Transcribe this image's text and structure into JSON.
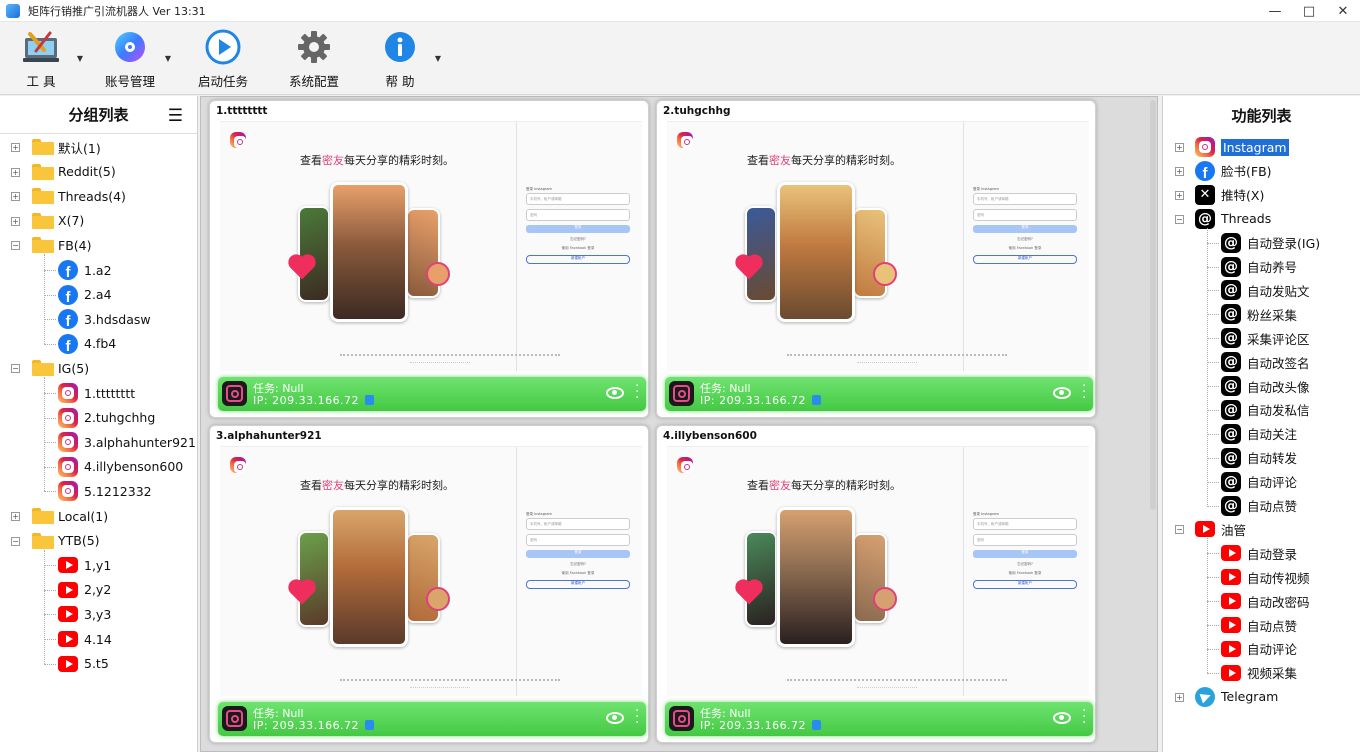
{
  "window": {
    "title": "矩阵行销推广引流机器人 Ver 13:31"
  },
  "toolbar": {
    "items": [
      {
        "label": "工  具",
        "icon": "tools-icon",
        "dropdown": true
      },
      {
        "label": "账号管理",
        "icon": "account-disc-icon",
        "dropdown": true
      },
      {
        "label": "启动任务",
        "icon": "play-icon",
        "dropdown": false
      },
      {
        "label": "系统配置",
        "icon": "gear-icon",
        "dropdown": false
      },
      {
        "label": "帮  助",
        "icon": "info-icon",
        "dropdown": true
      }
    ]
  },
  "groups": {
    "title": "分组列表",
    "nodes": [
      {
        "label": "默认(1)",
        "type": "folder",
        "level": 0
      },
      {
        "label": "Reddit(5)",
        "type": "folder",
        "level": 0
      },
      {
        "label": "Threads(4)",
        "type": "folder",
        "level": 0
      },
      {
        "label": "X(7)",
        "type": "folder",
        "level": 0
      },
      {
        "label": "FB(4)",
        "type": "folder",
        "level": 0,
        "expanded": true
      },
      {
        "label": "1.a2",
        "type": "fb",
        "level": 1
      },
      {
        "label": "2.a4",
        "type": "fb",
        "level": 1
      },
      {
        "label": "3.hdsdasw",
        "type": "fb",
        "level": 1
      },
      {
        "label": "4.fb4",
        "type": "fb",
        "level": 1
      },
      {
        "label": "IG(5)",
        "type": "folder",
        "level": 0,
        "expanded": true
      },
      {
        "label": "1.tttttttt",
        "type": "ig",
        "level": 1
      },
      {
        "label": "2.tuhgchhg",
        "type": "ig",
        "level": 1
      },
      {
        "label": "3.alphahunter921",
        "type": "ig",
        "level": 1
      },
      {
        "label": "4.illybenson600",
        "type": "ig",
        "level": 1
      },
      {
        "label": "5.1212332",
        "type": "ig",
        "level": 1
      },
      {
        "label": "Local(1)",
        "type": "folder",
        "level": 0
      },
      {
        "label": "YTB(5)",
        "type": "folder",
        "level": 0,
        "expanded": true
      },
      {
        "label": "1,y1",
        "type": "yt",
        "level": 1
      },
      {
        "label": "2,y2",
        "type": "yt",
        "level": 1
      },
      {
        "label": "3,y3",
        "type": "yt",
        "level": 1
      },
      {
        "label": "4.14",
        "type": "yt",
        "level": 1
      },
      {
        "label": "5.t5",
        "type": "yt",
        "level": 1
      }
    ]
  },
  "browsers": [
    {
      "title": "1.tttttttt",
      "task": "任务: Null",
      "ip": "IP: 209.33.166.72"
    },
    {
      "title": "2.tuhgchhg",
      "task": "任务: Null",
      "ip": "IP: 209.33.166.72"
    },
    {
      "title": "3.alphahunter921",
      "task": "任务: Null",
      "ip": "IP: 209.33.166.72"
    },
    {
      "title": "4.illybenson600",
      "task": "任务: Null",
      "ip": "IP: 209.33.166.72"
    }
  ],
  "ig_page": {
    "slogan_pre": "查看",
    "slogan_hl": "密友",
    "slogan_post": "每天分享的精彩时刻。"
  },
  "functions": {
    "title": "功能列表",
    "nodes": [
      {
        "label": "Instagram",
        "type": "ig",
        "level": 0,
        "selected": true
      },
      {
        "label": "脸书(FB)",
        "type": "fb",
        "level": 0
      },
      {
        "label": "推特(X)",
        "type": "x",
        "level": 0
      },
      {
        "label": "Threads",
        "type": "th",
        "level": 0,
        "expanded": true
      },
      {
        "label": "自动登录(IG)",
        "type": "th",
        "level": 1
      },
      {
        "label": "自动养号",
        "type": "th",
        "level": 1
      },
      {
        "label": "自动发贴文",
        "type": "th",
        "level": 1
      },
      {
        "label": "粉丝采集",
        "type": "th",
        "level": 1
      },
      {
        "label": "采集评论区",
        "type": "th",
        "level": 1
      },
      {
        "label": "自动改签名",
        "type": "th",
        "level": 1
      },
      {
        "label": "自动改头像",
        "type": "th",
        "level": 1
      },
      {
        "label": "自动发私信",
        "type": "th",
        "level": 1
      },
      {
        "label": "自动关注",
        "type": "th",
        "level": 1
      },
      {
        "label": "自动转发",
        "type": "th",
        "level": 1
      },
      {
        "label": "自动评论",
        "type": "th",
        "level": 1
      },
      {
        "label": "自动点赞",
        "type": "th",
        "level": 1
      },
      {
        "label": "油管",
        "type": "yt",
        "level": 0,
        "expanded": true
      },
      {
        "label": "自动登录",
        "type": "yt",
        "level": 1
      },
      {
        "label": "自动传视频",
        "type": "yt",
        "level": 1
      },
      {
        "label": "自动改密码",
        "type": "yt",
        "level": 1
      },
      {
        "label": "自动点赞",
        "type": "yt",
        "level": 1
      },
      {
        "label": "自动评论",
        "type": "yt",
        "level": 1
      },
      {
        "label": "视频采集",
        "type": "yt",
        "level": 1
      },
      {
        "label": "Telegram",
        "type": "tg",
        "level": 0
      }
    ]
  }
}
